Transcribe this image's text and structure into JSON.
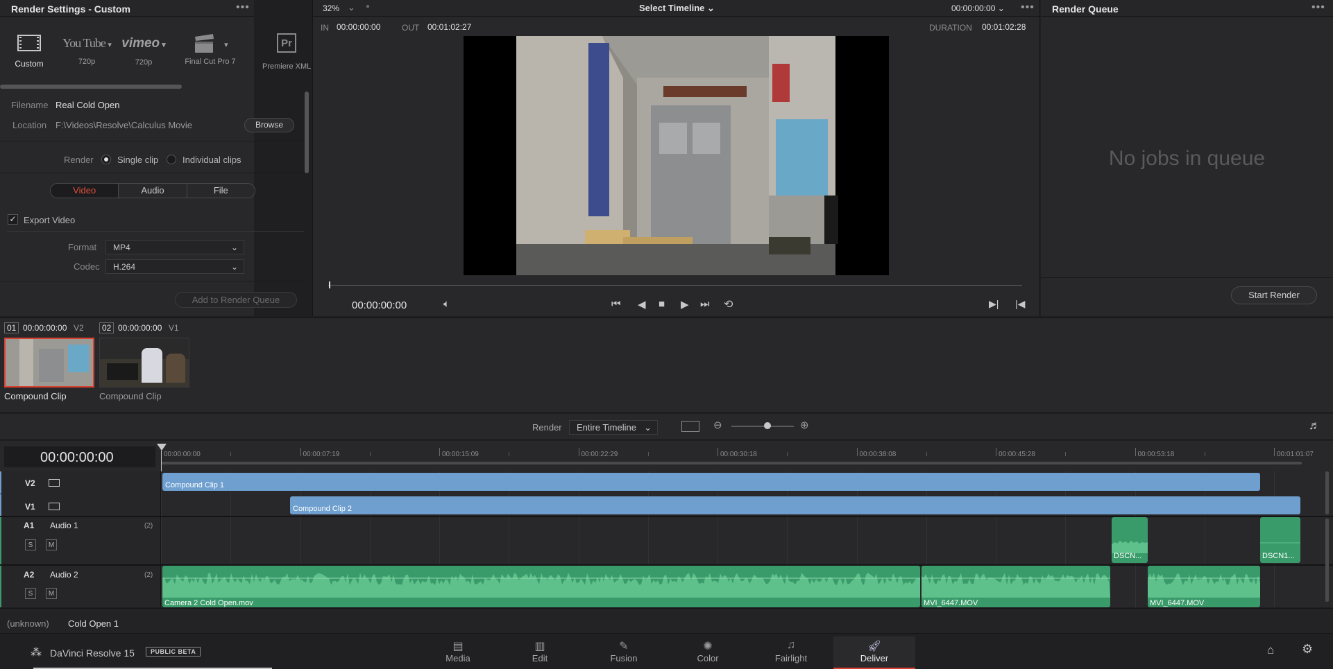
{
  "render_settings": {
    "title": "Render Settings - Custom",
    "presets": [
      {
        "name": "Custom",
        "sub": ""
      },
      {
        "name": "You Tube",
        "sub": "720p"
      },
      {
        "name": "vimeo",
        "sub": "720p"
      },
      {
        "name": "",
        "sub": "Final Cut Pro 7"
      },
      {
        "name": "Pr",
        "sub": "Premiere XML"
      }
    ],
    "filename_label": "Filename",
    "filename_value": "Real Cold Open",
    "location_label": "Location",
    "location_value": "F:\\Videos\\Resolve\\Calculus Movie",
    "browse_label": "Browse",
    "render_label": "Render",
    "single_clip_label": "Single clip",
    "individual_clips_label": "Individual clips",
    "tabs": [
      "Video",
      "Audio",
      "File"
    ],
    "export_video_label": "Export Video",
    "format_label": "Format",
    "format_value": "MP4",
    "codec_label": "Codec",
    "codec_value": "H.264",
    "add_to_queue_label": "Add to Render Queue"
  },
  "viewer": {
    "zoom": "32%",
    "timeline_select": "Select Timeline",
    "timecode_top": "00:00:00:00",
    "in_label": "IN",
    "in_value": "00:00:00:00",
    "out_label": "OUT",
    "out_value": "00:01:02:27",
    "duration_label": "DURATION",
    "duration_value": "00:01:02:28",
    "current_timecode": "00:00:00:00",
    "playhead_progress": 0.0
  },
  "render_queue": {
    "title": "Render Queue",
    "empty_text": "No jobs in queue",
    "start_render_label": "Start Render"
  },
  "clip_thumbs": [
    {
      "index": "01",
      "timecode": "00:00:00:00",
      "track": "V2",
      "label": "Compound Clip"
    },
    {
      "index": "02",
      "timecode": "00:00:00:00",
      "track": "V1",
      "label": "Compound Clip"
    }
  ],
  "timeline_toolbar": {
    "render_label": "Render",
    "render_value": "Entire Timeline"
  },
  "timeline": {
    "timecode": "00:00:00:00",
    "ruler": [
      "00:00:00:00",
      "00:00:07:19",
      "00:00:15:09",
      "00:00:22:29",
      "00:00:30:18",
      "00:00:38:08",
      "00:00:45:28",
      "00:00:53:18",
      "00:01:01:07"
    ],
    "tracks": {
      "v2": {
        "id": "V2",
        "clips": [
          "Compound Clip 1"
        ]
      },
      "v1": {
        "id": "V1",
        "clips": [
          "Compound Clip 2"
        ]
      },
      "a1": {
        "id": "A1",
        "name": "Audio 1",
        "channels": "(2)",
        "clips": [
          "DSCN...",
          "DSCN1..."
        ]
      },
      "a2": {
        "id": "A2",
        "name": "Audio 2",
        "channels": "(2)",
        "clips": [
          "Camera 2 Cold Open.mov",
          "MVI_6447.MOV",
          "MVI_6447.MOV"
        ]
      }
    },
    "solo_label": "S",
    "mute_label": "M"
  },
  "status_bar": {
    "left": "(unknown)",
    "timeline_name": "Cold Open 1"
  },
  "bottom_bar": {
    "app_name": "DaVinci Resolve 15",
    "beta_badge": "PUBLIC BETA",
    "pages": [
      "Media",
      "Edit",
      "Fusion",
      "Color",
      "Fairlight",
      "Deliver"
    ],
    "active_page": "Deliver"
  }
}
